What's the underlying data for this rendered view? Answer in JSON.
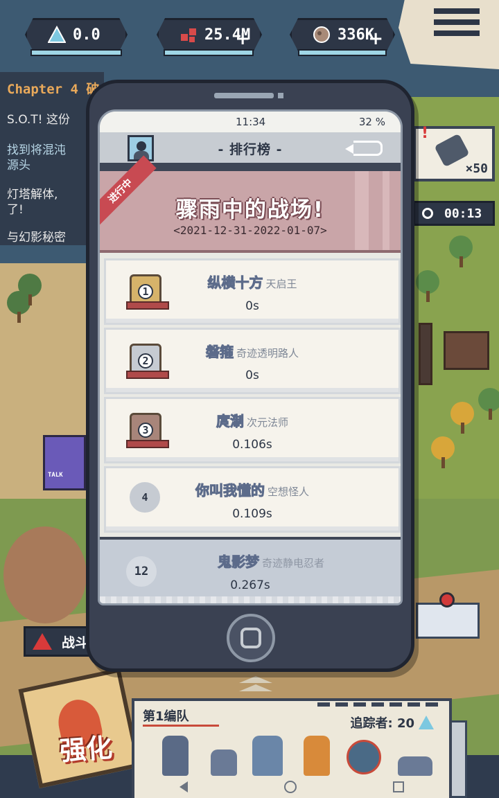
{
  "resources": [
    {
      "icon": "crystal-triangle-icon",
      "value": "0.0",
      "has_plus": false
    },
    {
      "icon": "red-cubes-icon",
      "value": "25.4M",
      "has_plus": true
    },
    {
      "icon": "ore-rock-icon",
      "value": "336K",
      "has_plus": true
    }
  ],
  "quest": {
    "chapter": "Chapter 4 破",
    "lines": [
      "S.O.T! 这份",
      "找到将混沌\n源头",
      "灯塔解体,\n了!",
      "与幻影秘密"
    ]
  },
  "item_card": {
    "quantity": "×50",
    "alert": "!"
  },
  "timer": "00:13",
  "phone": {
    "status_time": "11:34",
    "battery": "32 %",
    "title": "- 排行榜 -",
    "event": {
      "ribbon": "进行中",
      "name": "骤雨中的战场!",
      "dates": "<2021-12-31-2022-01-07>"
    },
    "leaderboard": [
      {
        "rank": "1",
        "medal": "gold",
        "player": "纵横十方",
        "title": "天启王",
        "score": "0s"
      },
      {
        "rank": "2",
        "medal": "silver",
        "player": "磐箍",
        "title": "奇迹透明路人",
        "score": "0s"
      },
      {
        "rank": "3",
        "medal": "bronze",
        "player": "庹淛",
        "title": "次元法师",
        "score": "0.106s"
      },
      {
        "rank": "4",
        "medal": "plain",
        "player": "你叫我懂的",
        "title": "空想怪人",
        "score": "0.109s"
      }
    ],
    "me": {
      "rank": "12",
      "player": "鬼影梦",
      "title": "奇迹静电忍者",
      "score": "0.267s"
    }
  },
  "battle_label": "战斗",
  "upgrade_label": "强化",
  "squad": {
    "name": "第1编队",
    "trackers_label": "追踪者: 20"
  },
  "colors": {
    "accent_red": "#c84a52",
    "panel_dark": "#2d3646",
    "event_pink": "#c9a5a8"
  }
}
